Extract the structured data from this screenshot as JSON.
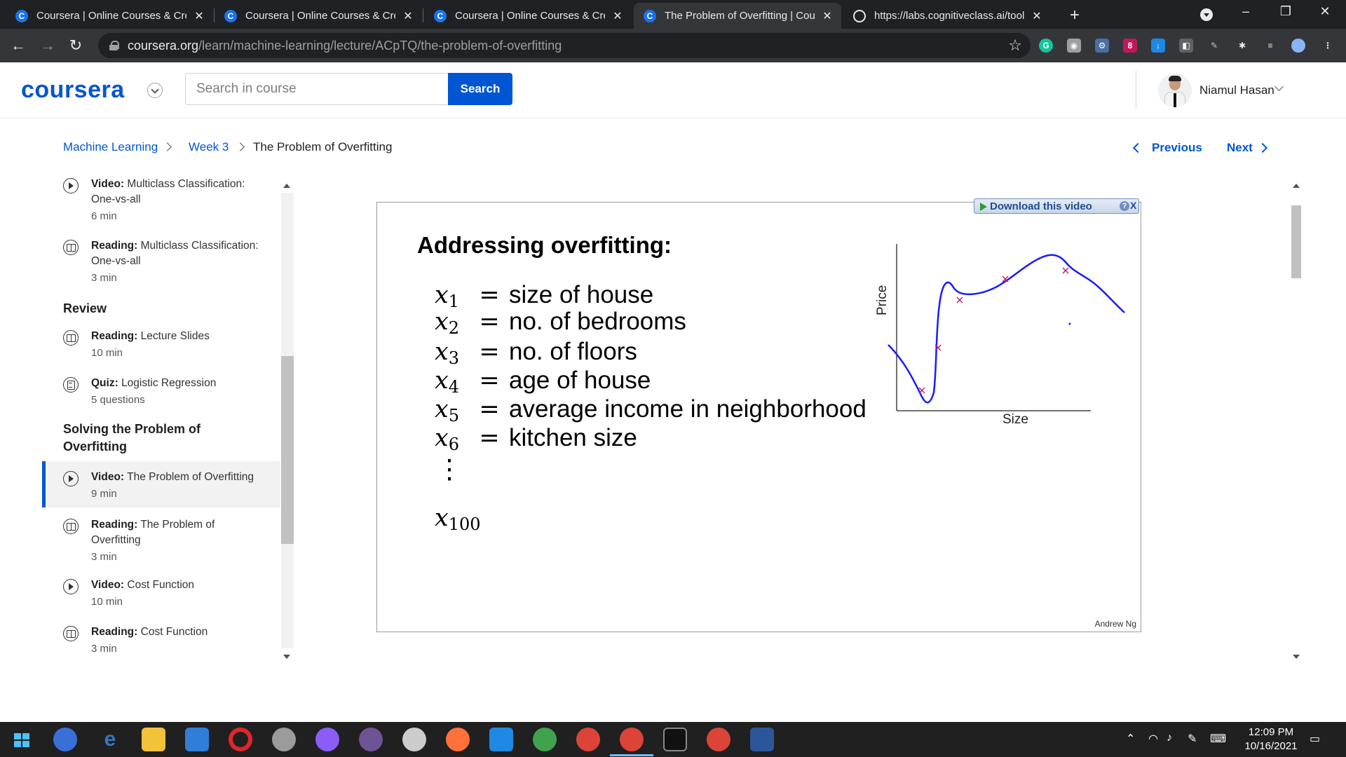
{
  "browser": {
    "tabs": [
      {
        "title": "Coursera | Online Courses & Credentials",
        "favicon": "coursera-icon",
        "active": false
      },
      {
        "title": "Coursera | Online Courses & Credentials",
        "favicon": "coursera-icon",
        "active": false
      },
      {
        "title": "Coursera | Online Courses & Credentials",
        "favicon": "coursera-icon",
        "active": false
      },
      {
        "title": "The Problem of Overfitting | Coursera",
        "favicon": "coursera-icon",
        "active": true
      },
      {
        "title": "https://labs.cognitiveclass.ai/tools",
        "favicon": "globe-icon",
        "active": false
      }
    ],
    "url_host": "coursera.org",
    "url_path": "/learn/machine-learning/lecture/ACpTQ/the-problem-of-overfitting",
    "extension_badge": "8"
  },
  "header": {
    "logo": "coursera",
    "search_placeholder": "Search in course",
    "search_button": "Search",
    "user_name": "Niamul Hasan"
  },
  "breadcrumb": {
    "course": "Machine Learning",
    "week": "Week 3",
    "current": "The Problem of Overfitting"
  },
  "nav": {
    "previous": "Previous",
    "next": "Next"
  },
  "sidebar": {
    "items_top": [
      {
        "type": "Video:",
        "title": "Multiclass Classification: One-vs-all",
        "duration": "6 min",
        "icon": "play-icon"
      },
      {
        "type": "Reading:",
        "title": "Multiclass Classification: One-vs-all",
        "duration": "3 min",
        "icon": "book-icon"
      }
    ],
    "section_review": "Review",
    "items_review": [
      {
        "type": "Reading:",
        "title": "Lecture Slides",
        "duration": "10 min",
        "icon": "book-icon"
      },
      {
        "type": "Quiz:",
        "title": "Logistic Regression",
        "duration": "5 questions",
        "icon": "quiz-icon"
      }
    ],
    "section_solving": "Solving the Problem of Overfitting",
    "items_solving": [
      {
        "type": "Video:",
        "title": "The Problem of Overfitting",
        "duration": "9 min",
        "icon": "play-icon",
        "active": true
      },
      {
        "type": "Reading:",
        "title": "The Problem of Overfitting",
        "duration": "3 min",
        "icon": "book-icon"
      },
      {
        "type": "Video:",
        "title": "Cost Function",
        "duration": "10 min",
        "icon": "play-icon"
      },
      {
        "type": "Reading:",
        "title": "Cost Function",
        "duration": "3 min",
        "icon": "book-icon"
      }
    ]
  },
  "slide": {
    "download_label": "Download this video",
    "help": "?",
    "close": "X",
    "title": "Addressing overfitting:",
    "features": [
      {
        "var": "x",
        "sub": "1",
        "eq": "=",
        "desc": "size of house"
      },
      {
        "var": "x",
        "sub": "2",
        "eq": "=",
        "desc": "no. of bedrooms"
      },
      {
        "var": "x",
        "sub": "3",
        "eq": "=",
        "desc": "no. of floors"
      },
      {
        "var": "x",
        "sub": "4",
        "eq": "=",
        "desc": "age of house"
      },
      {
        "var": "x",
        "sub": "5",
        "eq": "=",
        "desc": "average income in neighborhood"
      },
      {
        "var": "x",
        "sub": "6",
        "eq": "=",
        "desc": "kitchen size"
      }
    ],
    "vdots": "⋮",
    "last_var": "x",
    "last_sub": "100",
    "credit": "Andrew Ng",
    "plot": {
      "ylabel": "Price",
      "xlabel": "Size"
    }
  },
  "taskbar": {
    "time": "12:09 PM",
    "date": "10/16/2021"
  },
  "colors": {
    "brand": "#0056d2",
    "chrome_dark": "#202124",
    "chrome_mid": "#35363a",
    "curve": "#1a1aff",
    "marker": "#c0206a"
  }
}
